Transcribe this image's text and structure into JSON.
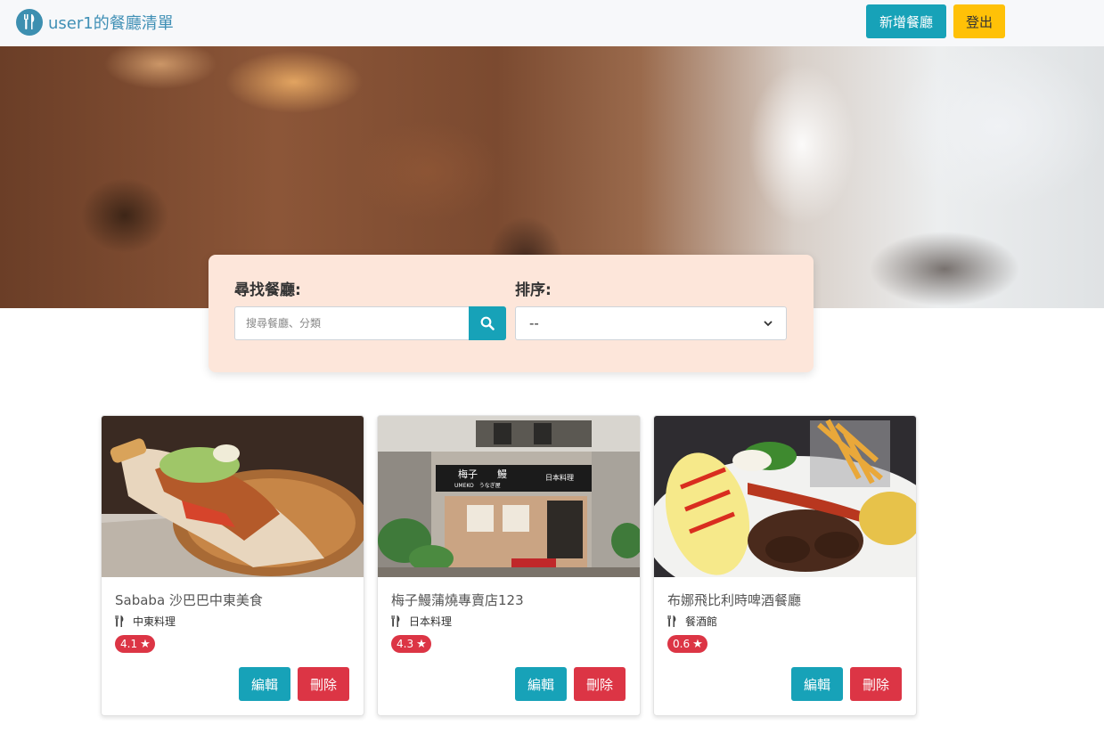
{
  "navbar": {
    "brand_title": "user1的餐廳清單",
    "add_button": "新增餐廳",
    "logout_button": "登出"
  },
  "search": {
    "search_label": "尋找餐廳:",
    "search_placeholder": "搜尋餐廳、分類",
    "sort_label": "排序:",
    "sort_selected": "--"
  },
  "restaurants": [
    {
      "name": "Sababa 沙巴巴中東美食",
      "category": "中東料理",
      "rating": "4.1",
      "edit_label": "編輯",
      "delete_label": "刪除"
    },
    {
      "name": "梅子鰻蒲燒專賣店123",
      "category": "日本料理",
      "rating": "4.3",
      "edit_label": "編輯",
      "delete_label": "刪除"
    },
    {
      "name": "布娜飛比利時啤酒餐廳",
      "category": "餐酒館",
      "rating": "0.6",
      "edit_label": "編輯",
      "delete_label": "刪除"
    }
  ],
  "restaurant_sign": {
    "main": "梅子　　鰻",
    "sub": "UMEKO　うなぎ屋",
    "right": "日本料理"
  },
  "colors": {
    "primary": "#17a2b8",
    "warning": "#ffc107",
    "danger": "#dc3545",
    "panel": "#fde6da",
    "brand": "#3f8fb5"
  }
}
